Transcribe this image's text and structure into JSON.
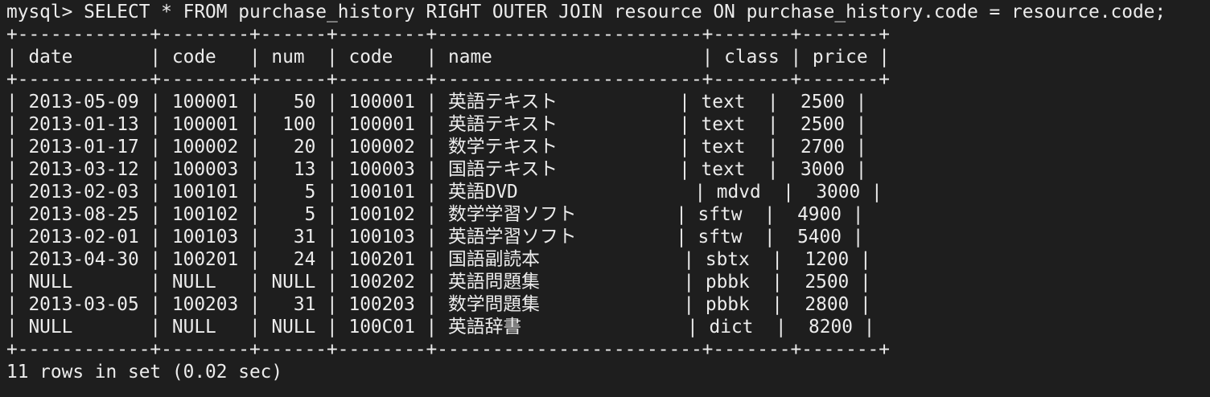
{
  "prompt": "mysql> ",
  "command": "SELECT * FROM purchase_history RIGHT OUTER JOIN resource ON purchase_history.code = resource.code;",
  "table": {
    "border": "+------------+--------+------+--------+------------------------+-------+-------+",
    "header": "| date       | code   | num  | code   | name                   | class | price |",
    "rows": [
      "| 2013-05-09 | 100001 |   50 | 100001 | 英語テキスト           | text  |  2500 |",
      "| 2013-01-13 | 100001 |  100 | 100001 | 英語テキスト           | text  |  2500 |",
      "| 2013-01-17 | 100002 |   20 | 100002 | 数学テキスト           | text  |  2700 |",
      "| 2013-03-12 | 100003 |   13 | 100003 | 国語テキスト           | text  |  3000 |",
      "| 2013-02-03 | 100101 |    5 | 100101 | 英語DVD                | mdvd  |  3000 |",
      "| 2013-08-25 | 100102 |    5 | 100102 | 数学学習ソフト         | sftw  |  4900 |",
      "| 2013-02-01 | 100103 |   31 | 100103 | 英語学習ソフト         | sftw  |  5400 |",
      "| 2013-04-30 | 100201 |   24 | 100201 | 国語副読本             | sbtx  |  1200 |",
      "| NULL       | NULL   | NULL | 100202 | 英語問題集             | pbbk  |  2500 |",
      "| 2013-03-05 | 100203 |   31 | 100203 | 数学問題集             | pbbk  |  2800 |",
      "| NULL       | NULL   | NULL | 100C01 | 英語辞書               | dict  |  8200 |"
    ]
  },
  "summary": "11 rows in set (0.02 sec)"
}
